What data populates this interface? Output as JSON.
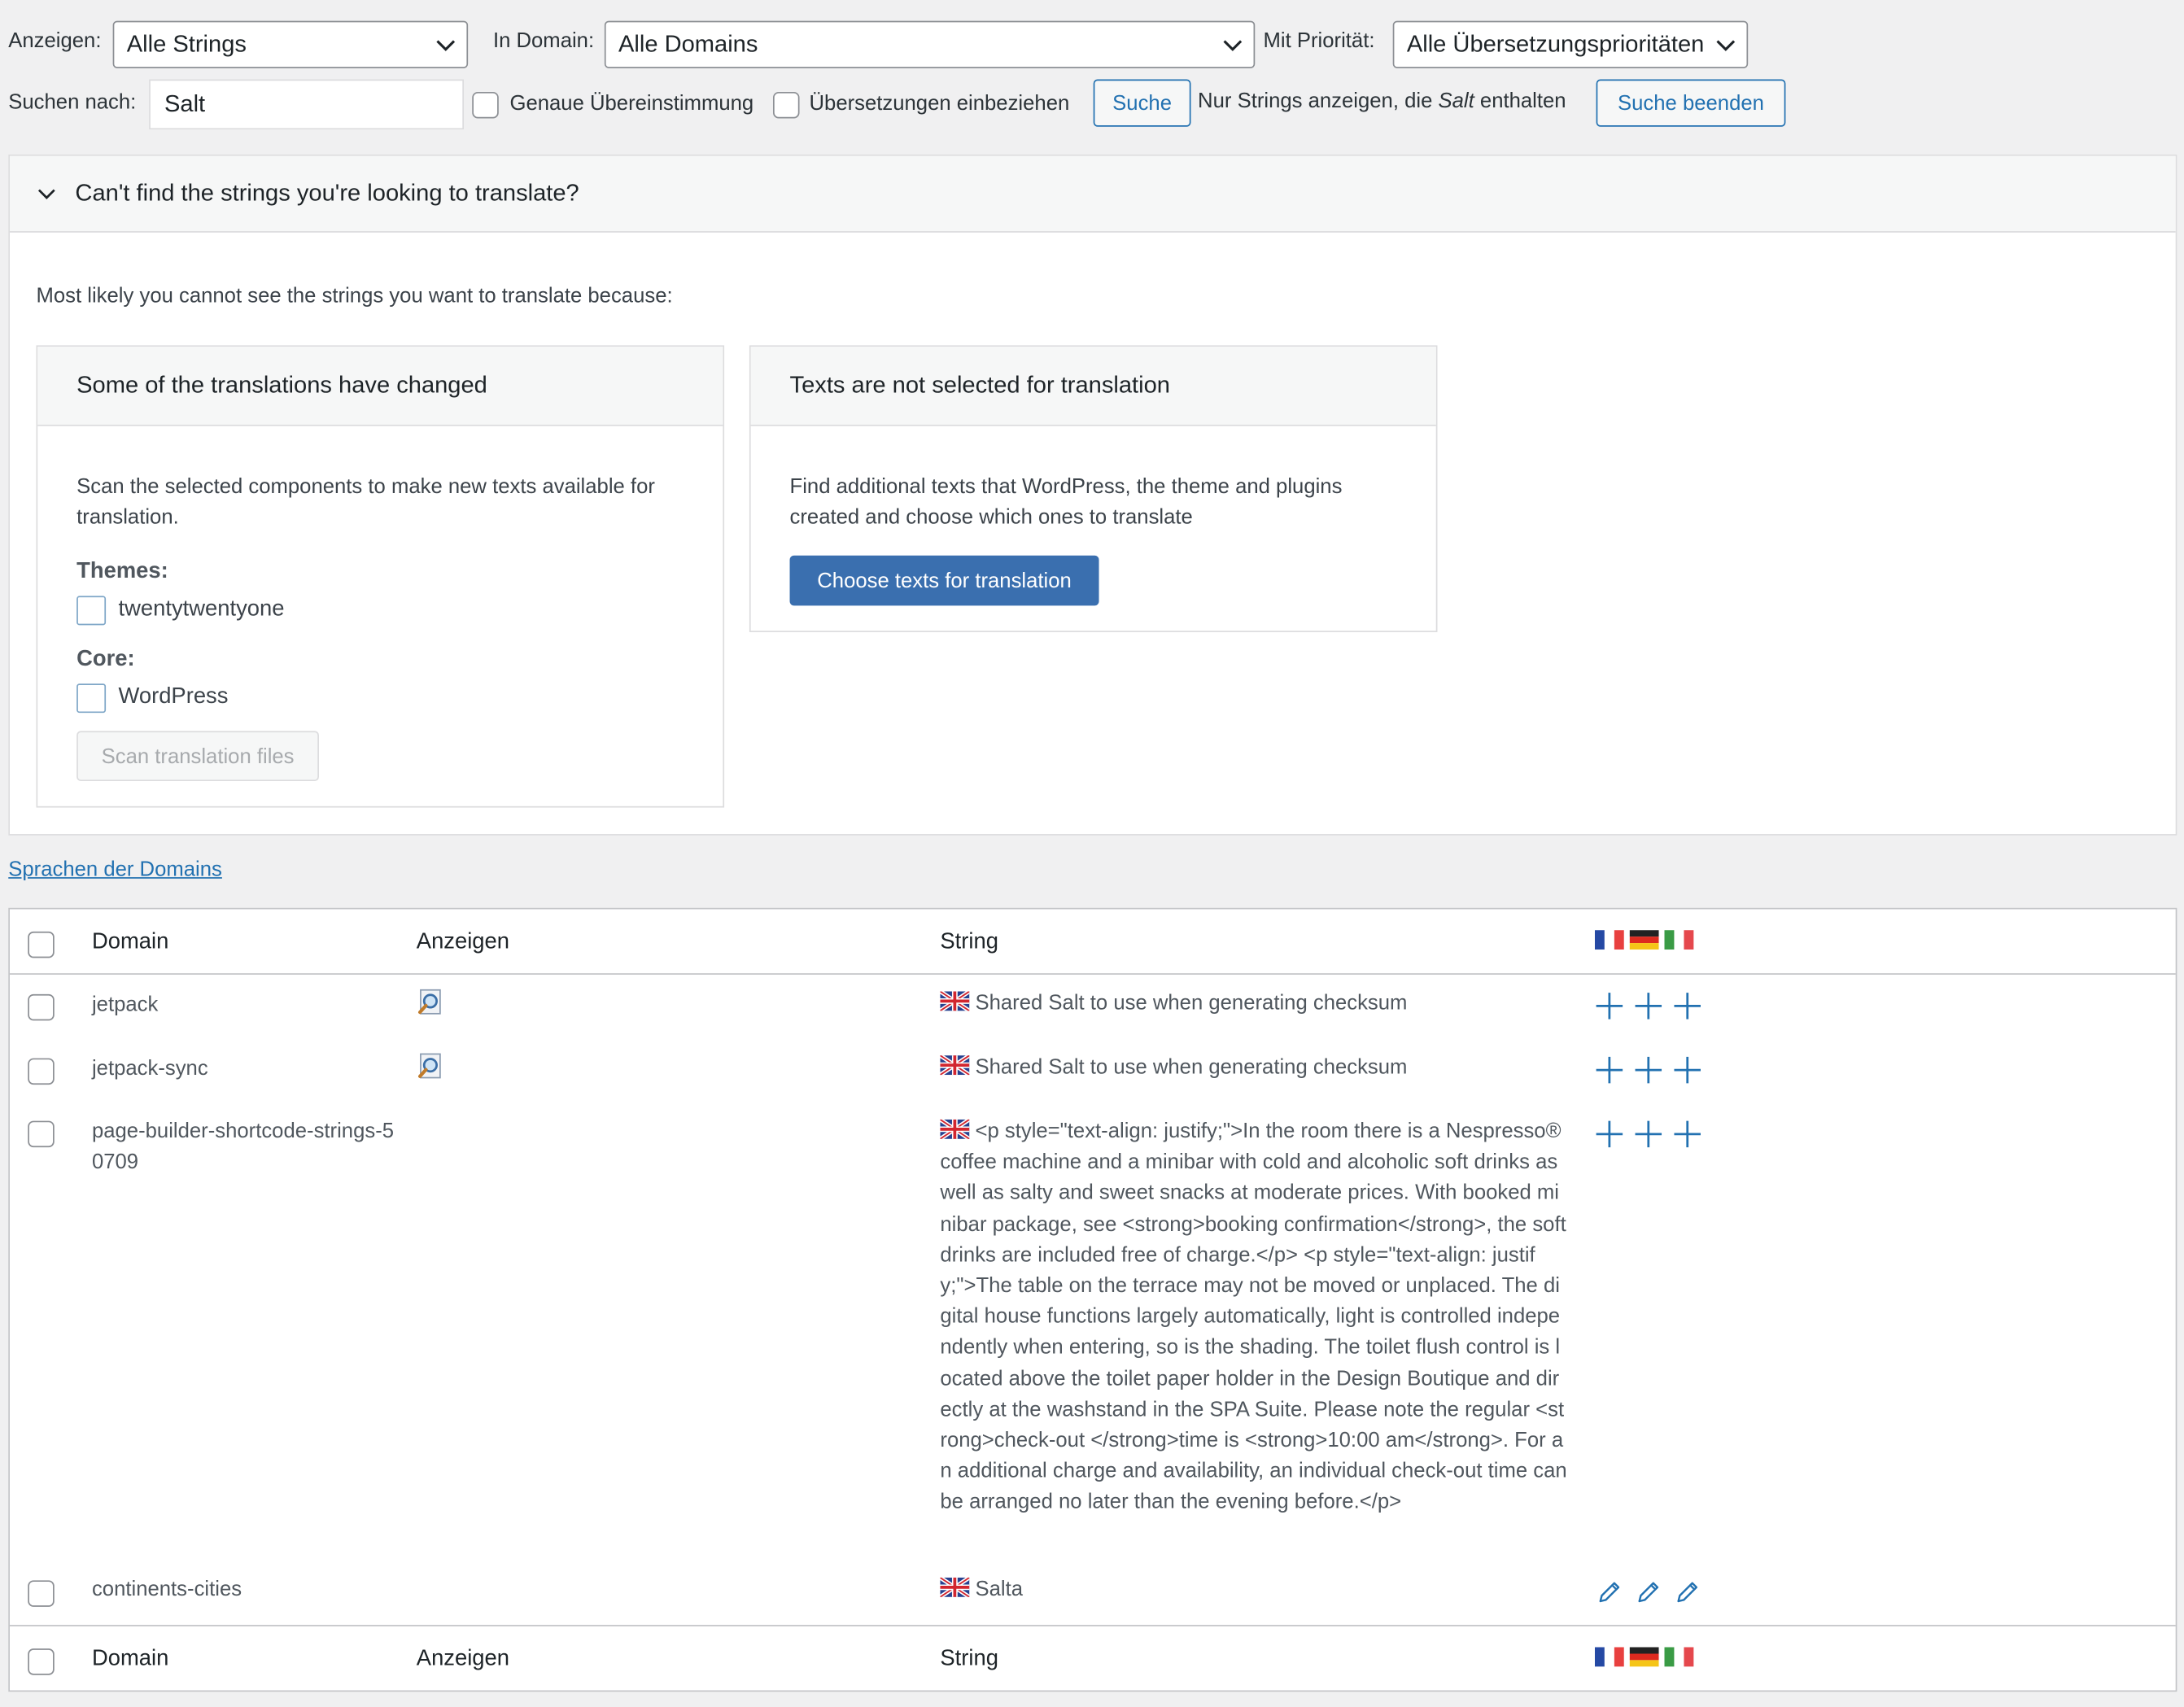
{
  "filters": {
    "show_label": "Anzeigen:",
    "show_value": "Alle Strings",
    "domain_label": "In Domain:",
    "domain_value": "Alle Domains",
    "priority_label": "Mit Priorität:",
    "priority_value": "Alle Übersetzungsprioritäten",
    "search_label": "Suchen nach:",
    "search_value": "Salt",
    "exact_match_label": "Genaue Übereinstimmung",
    "include_translations_label": "Übersetzungen einbeziehen",
    "search_button": "Suche",
    "notice_prefix": "Nur Strings anzeigen, die ",
    "notice_term": "Salt",
    "notice_suffix": " enthalten",
    "end_search_button": "Suche beenden"
  },
  "help_panel": {
    "title": "Can't find the strings you're looking to translate?",
    "intro": "Most likely you cannot see the strings you want to translate because:",
    "left": {
      "title": "Some of the translations have changed",
      "text": "Scan the selected components to make new texts available for translation.",
      "themes_label": "Themes:",
      "theme_item": "twentytwentyone",
      "core_label": "Core:",
      "core_item": "WordPress",
      "scan_button": "Scan translation files"
    },
    "right": {
      "title": "Texts are not selected for translation",
      "text": "Find additional texts that WordPress, the theme and plugins created and choose which ones to translate",
      "choose_button": "Choose texts for translation"
    }
  },
  "domains_link": "Sprachen der Domains",
  "table": {
    "col_domain": "Domain",
    "col_view": "Anzeigen",
    "col_string": "String",
    "flags": [
      "fr-flag",
      "de-flag",
      "it-flag"
    ],
    "source_flag": "uk-flag",
    "rows": [
      {
        "domain": "jetpack",
        "string": "Shared Salt to use when generating checksum",
        "has_view_icon": true,
        "action": "plus-icon"
      },
      {
        "domain": "jetpack-sync",
        "string": "Shared Salt to use when generating checksum",
        "has_view_icon": true,
        "action": "plus-icon"
      },
      {
        "domain": "page-builder-shortcode-strings-50709",
        "string": "<p style=\"text-align: justify;\">In the room there is a Nespresso® coffee machine and a minibar with cold and alcoholic soft drinks as well as salty and sweet snacks at moderate prices. With booked minibar package, see <strong>booking confirmation</strong>, the soft drinks are included free of charge.</p> <p style=\"text-align: justify;\">The table on the terrace may not be moved or unplaced. The digital house functions largely automatically, light is controlled independently when entering, so is the shading. The toilet flush control is located above the toilet paper holder in the Design Boutique and directly at the washstand in the SPA Suite. Please note the regular <strong>check-out </strong>time is <strong>10:00 am</strong>. For an additional charge and availability, an individual check-out time can be arranged no later than the evening before.</p>",
        "has_view_icon": false,
        "action": "plus-icon"
      },
      {
        "domain": "continents-cities",
        "string": "Salta",
        "has_view_icon": false,
        "action": "pencil-icon"
      }
    ]
  },
  "colors": {
    "accent": "#2271b1",
    "primary_button": "#3a6faf",
    "background": "#f0f0f1"
  }
}
